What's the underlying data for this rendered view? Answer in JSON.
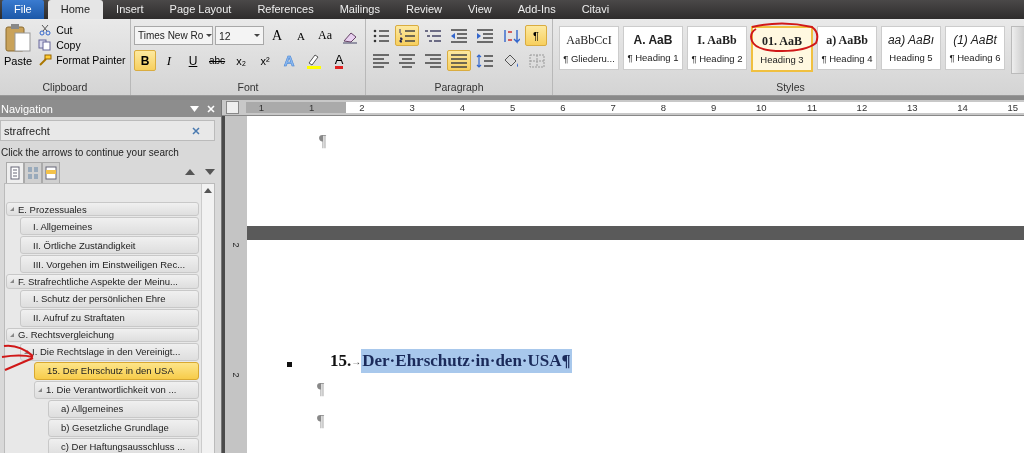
{
  "ribbon_tabs": [
    {
      "label": "File",
      "kind": "file",
      "selected": false
    },
    {
      "label": "Home",
      "kind": "tab",
      "selected": true
    },
    {
      "label": "Insert",
      "kind": "tab",
      "selected": false
    },
    {
      "label": "Page Layout",
      "kind": "tab",
      "selected": false
    },
    {
      "label": "References",
      "kind": "tab",
      "selected": false
    },
    {
      "label": "Mailings",
      "kind": "tab",
      "selected": false
    },
    {
      "label": "Review",
      "kind": "tab",
      "selected": false
    },
    {
      "label": "View",
      "kind": "tab",
      "selected": false
    },
    {
      "label": "Add-Ins",
      "kind": "tab",
      "selected": false
    },
    {
      "label": "Citavi",
      "kind": "tab",
      "selected": false
    }
  ],
  "clipboard": {
    "paste": "Paste",
    "group_label": "Clipboard",
    "items": [
      {
        "label": "Cut",
        "kind": "scissors"
      },
      {
        "label": "Copy",
        "kind": "copy"
      },
      {
        "label": "Format Painter",
        "kind": "brush"
      }
    ]
  },
  "font": {
    "name": "Times New Ro",
    "size": "12",
    "group_label": "Font",
    "row1": [
      {
        "kind": "grow",
        "label": "A",
        "selected": false
      },
      {
        "kind": "shrink",
        "label": "A",
        "selected": false
      },
      {
        "kind": "case",
        "label": "Aa",
        "selected": false
      },
      {
        "kind": "clear",
        "selected": false
      }
    ],
    "row2": [
      {
        "kind": "bold",
        "label": "B",
        "selected": true
      },
      {
        "kind": "italic",
        "label": "I",
        "selected": false
      },
      {
        "kind": "underline",
        "label": "U",
        "selected": false
      },
      {
        "kind": "strike",
        "label": "abc",
        "selected": false
      },
      {
        "kind": "sub",
        "label": "x₂",
        "selected": false
      },
      {
        "kind": "sup",
        "label": "x²",
        "selected": false
      },
      {
        "kind": "effects",
        "label": "A",
        "selected": false
      },
      {
        "kind": "highlight",
        "selected": false
      },
      {
        "kind": "fontcolor",
        "label": "A",
        "selected": false
      }
    ]
  },
  "paragraph": {
    "group_label": "Paragraph",
    "row1": [
      {
        "kind": "bullets",
        "selected": false
      },
      {
        "kind": "numbering",
        "selected": true
      },
      {
        "kind": "multilevel",
        "selected": false
      },
      {
        "kind": "outdent",
        "selected": false
      },
      {
        "kind": "indent",
        "selected": false
      },
      {
        "kind": "sort",
        "selected": false
      },
      {
        "kind": "pilcrow",
        "label": "¶",
        "selected": true
      }
    ],
    "row2": [
      {
        "kind": "left",
        "selected": false
      },
      {
        "kind": "center",
        "selected": false
      },
      {
        "kind": "right",
        "selected": false
      },
      {
        "kind": "justify",
        "selected": true
      },
      {
        "kind": "spacing",
        "selected": false
      },
      {
        "kind": "shading",
        "selected": false
      },
      {
        "kind": "borders",
        "selected": false
      }
    ]
  },
  "styles": {
    "group_label": "Styles",
    "items": [
      {
        "preview": "AaBbCcI",
        "label": "¶ Gliederu...",
        "kind": "serif",
        "selected": false
      },
      {
        "preview": "A.  AaB",
        "label": "¶ Heading 1",
        "kind": "sansbold",
        "selected": false
      },
      {
        "preview": "I.  AaBb",
        "label": "¶ Heading 2",
        "kind": "serifbold",
        "selected": false
      },
      {
        "preview": "01.   AaB",
        "label": "Heading 3",
        "kind": "serifbold",
        "selected": true
      },
      {
        "preview": "a)  AaBb",
        "label": "¶ Heading 4",
        "kind": "serifbold",
        "selected": false
      },
      {
        "preview": "aa)  AaBı",
        "label": "Heading 5",
        "kind": "sansitalic",
        "selected": false
      },
      {
        "preview": "(1)  AaBt",
        "label": "¶ Heading 6",
        "kind": "sansitalic",
        "selected": false
      }
    ]
  },
  "navigation": {
    "title": "Navigation",
    "search": "strafrecht",
    "hint": "Click the arrows to continue your search",
    "views": [
      {
        "kind": "headings",
        "selected": true
      },
      {
        "kind": "pages",
        "selected": false
      },
      {
        "kind": "results",
        "selected": false
      }
    ],
    "tree": [
      {
        "label": "E. Prozessuales",
        "expanded": true,
        "selected": false,
        "children": [
          {
            "label": "I. Allgemeines",
            "selected": false
          },
          {
            "label": "II. Örtliche Zuständigkeit",
            "selected": false
          },
          {
            "label": "III. Vorgehen im Einstweiligen Rec...",
            "selected": false
          }
        ]
      },
      {
        "label": "F. Strafrechtliche Aspekte der Meinu...",
        "expanded": true,
        "selected": false,
        "children": [
          {
            "label": "I. Schutz der persönlichen Ehre",
            "selected": false
          },
          {
            "label": "II. Aufruf zu Straftaten",
            "selected": false
          }
        ]
      },
      {
        "label": "G. Rechtsvergleichung",
        "expanded": true,
        "selected": false,
        "children": [
          {
            "label": "I. Die Rechtslage in den Vereinigt...",
            "expanded": true,
            "selected": false,
            "children": [
              {
                "label": "15. Der Ehrschutz in den USA",
                "selected": true
              },
              {
                "label": "1. Die Verantwortlichkeit von ...",
                "expanded": true,
                "selected": false,
                "children": [
                  {
                    "label": "a) Allgemeines",
                    "selected": false
                  },
                  {
                    "label": "b) Gesetzliche Grundlage",
                    "selected": false
                  },
                  {
                    "label": "c) Der Haftungsausschluss ...",
                    "selected": false
                  }
                ]
              }
            ]
          }
        ]
      }
    ]
  },
  "ruler": [
    "1",
    "1",
    "2",
    "3",
    "4",
    "5",
    "6",
    "7",
    "8",
    "9",
    "10",
    "11",
    "12",
    "13",
    "14",
    "15"
  ],
  "vertical_ruler": [
    "2",
    "2"
  ],
  "document": {
    "page1": [
      "¶"
    ],
    "heading": {
      "number": "15.",
      "tab": "→",
      "text": "Der·Ehrschutz·in·den·USA¶",
      "selected": true
    },
    "after": [
      "¶",
      "¶"
    ]
  }
}
